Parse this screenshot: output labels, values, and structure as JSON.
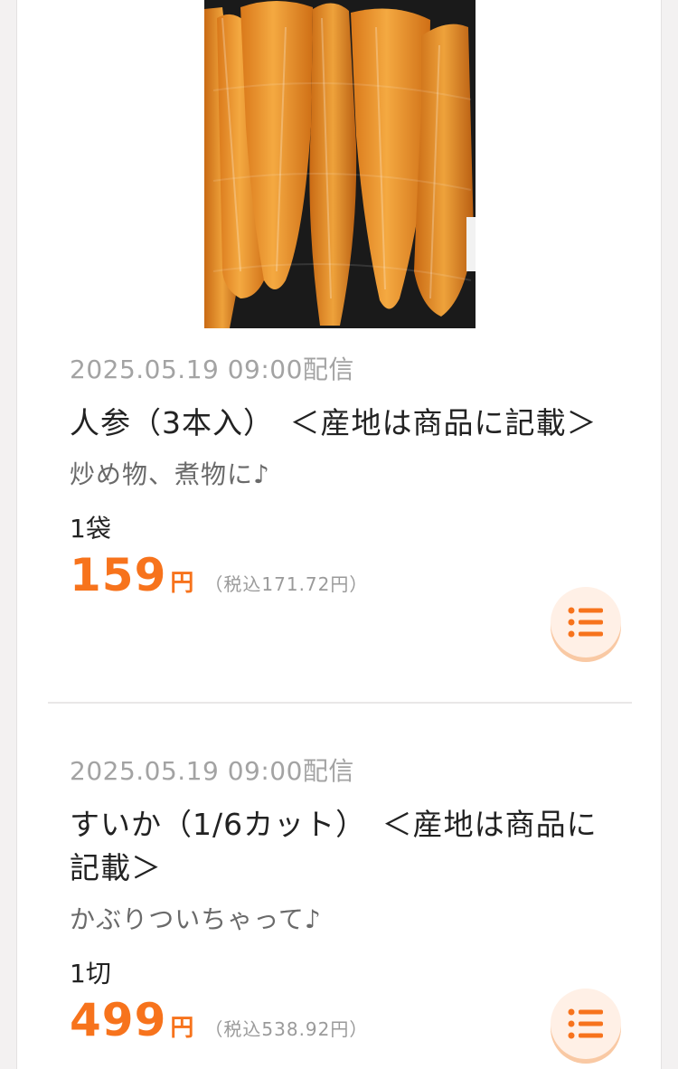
{
  "products": [
    {
      "timestamp": "2025.05.19 09:00配信",
      "title": "人参（3本入）　＜産地は商品に記載＞",
      "description": "炒め物、煮物に♪",
      "unit": "1袋",
      "price": "159",
      "currency": "円",
      "tax_included": "（税込171.72円）",
      "image": "carrots-photo"
    },
    {
      "timestamp": "2025.05.19 09:00配信",
      "title": "すいか（1/6カット）　＜産地は商品に記載＞",
      "description": "かぶりついちゃって♪",
      "unit": "1切",
      "price": "499",
      "currency": "円",
      "tax_included": "（税込538.92円）"
    }
  ],
  "icons": {
    "list_button": "list-icon"
  },
  "colors": {
    "price": "#f7731c",
    "button_bg": "#fff0e6",
    "button_shadow": "#f9c9a4",
    "timestamp": "#a3a3a3"
  }
}
